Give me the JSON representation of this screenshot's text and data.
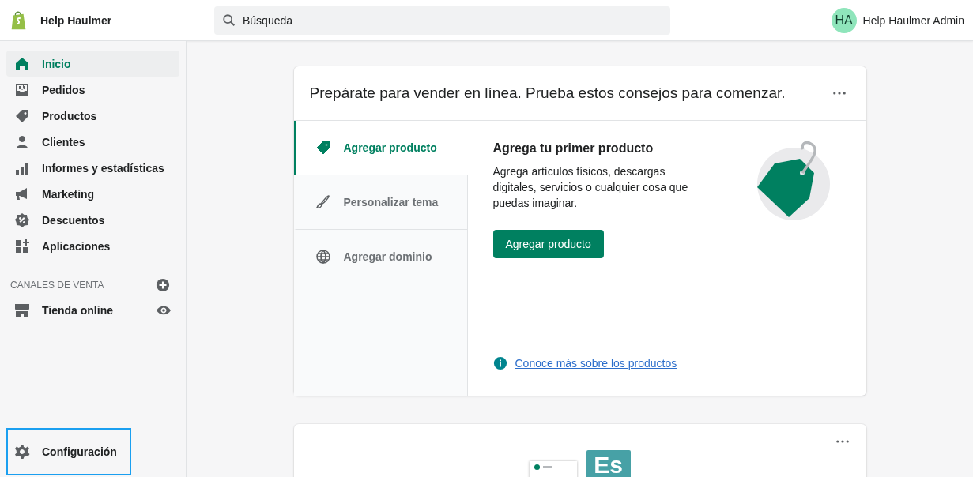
{
  "topbar": {
    "store_name": "Help Haulmer",
    "search": {
      "placeholder": "Búsqueda"
    },
    "user": {
      "initials": "HA",
      "name": "Help Haulmer Admin"
    }
  },
  "sidebar": {
    "items": [
      {
        "kind": "home",
        "label": "Inicio",
        "selected": true
      },
      {
        "kind": "orders",
        "label": "Pedidos",
        "selected": false
      },
      {
        "kind": "products",
        "label": "Productos",
        "selected": false
      },
      {
        "kind": "customers",
        "label": "Clientes",
        "selected": false
      },
      {
        "kind": "analytics",
        "label": "Informes y estadísticas",
        "selected": false
      },
      {
        "kind": "marketing",
        "label": "Marketing",
        "selected": false
      },
      {
        "kind": "discounts",
        "label": "Descuentos",
        "selected": false
      },
      {
        "kind": "apps",
        "label": "Aplicaciones",
        "selected": false
      }
    ],
    "sales_channels": {
      "heading": "CANALES DE VENTA",
      "items": [
        {
          "kind": "store",
          "label": "Tienda online",
          "selected": false
        }
      ]
    },
    "settings": {
      "label": "Configuración",
      "highlighted": true
    }
  },
  "setup_card": {
    "title": "Prepárate para vender en línea. Prueba estos consejos para comenzar.",
    "tabs": [
      {
        "kind": "product",
        "label": "Agregar producto",
        "selected": true
      },
      {
        "kind": "theme",
        "label": "Personalizar tema",
        "selected": false
      },
      {
        "kind": "domain",
        "label": "Agregar dominio",
        "selected": false
      }
    ],
    "panel": {
      "heading": "Agrega tu primer producto",
      "body": "Agrega artículos físicos, descargas digitales, servicios o cualquier cosa que puedas imaginar.",
      "button": "Agregar producto",
      "link": "Conoce más sobre los productos"
    }
  },
  "second_card": {
    "illustration_label": "Es"
  }
}
